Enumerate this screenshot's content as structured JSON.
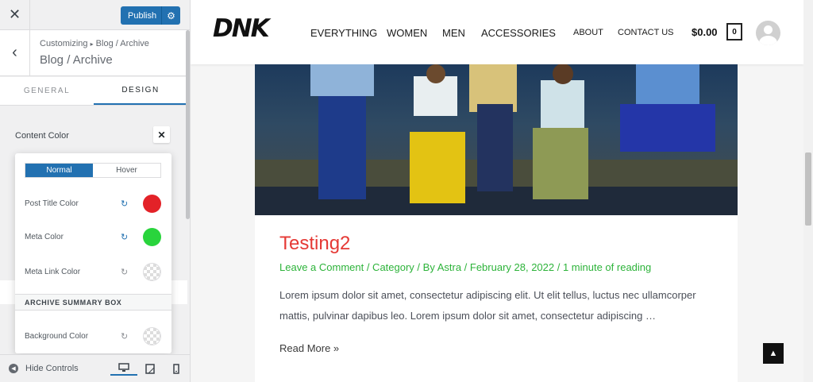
{
  "customizer": {
    "close_icon": "close-icon",
    "publish_label": "Publish",
    "publish_color": "#2271b1",
    "breadcrumb_prefix": "Customizing",
    "breadcrumb_sep": "▸",
    "breadcrumb_path": "Blog / Archive",
    "section_title": "Blog / Archive",
    "tabs": [
      {
        "label": "GENERAL",
        "active": false
      },
      {
        "label": "DESIGN",
        "active": true
      }
    ],
    "content_color_label": "Content Color",
    "close_popup_glyph": "✕",
    "popup": {
      "modes": [
        {
          "label": "Normal",
          "active": true
        },
        {
          "label": "Hover",
          "active": false
        }
      ],
      "rows": [
        {
          "label": "Post Title Color",
          "color": "#e32228"
        },
        {
          "label": "Meta Color",
          "color": "#29d43c"
        },
        {
          "label": "Meta Link Color",
          "color": "transparent"
        }
      ],
      "section_heading": "ARCHIVE SUMMARY BOX",
      "bg_row": {
        "label": "Background Color",
        "color": "transparent"
      }
    },
    "footer": {
      "hide_controls_label": "Hide Controls",
      "devices": [
        "desktop-icon",
        "tablet-icon",
        "mobile-icon"
      ]
    }
  },
  "site": {
    "logo_text": "DNK",
    "nav_main": [
      "EVERYTHING",
      "WOMEN",
      "MEN",
      "ACCESSORIES"
    ],
    "nav_secondary": [
      "ABOUT",
      "CONTACT US"
    ],
    "cart_total": "$0.00",
    "cart_count": "0",
    "post": {
      "title": "Testing2",
      "title_color": "#e53935",
      "meta": "Leave a Comment / Category / By Astra / February 28, 2022 / 1 minute of reading",
      "meta_color": "#2db33a",
      "excerpt": "Lorem ipsum dolor sit amet, consectetur adipiscing elit. Ut elit tellus, luctus nec ullamcorper mattis, pulvinar dapibus leo. Lorem ipsum dolor sit amet, consectetur adipiscing …",
      "read_more": "Read More »"
    }
  }
}
